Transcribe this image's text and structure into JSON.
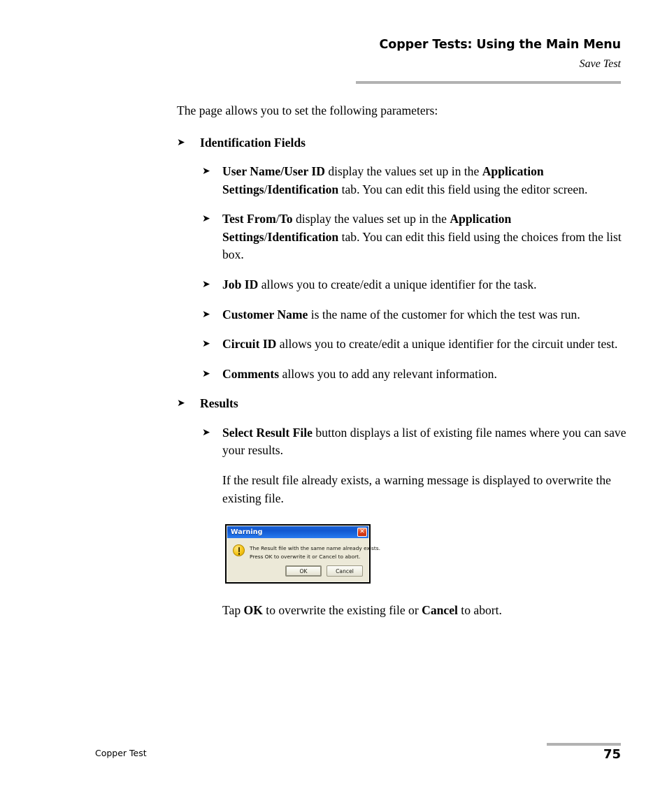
{
  "header": {
    "title": "Copper Tests: Using the Main Menu",
    "subtitle": "Save Test",
    "rule_color": "#b2b2b2"
  },
  "intro": "The page allows you to set the following parameters:",
  "bullet_glyph": "➤",
  "sections": [
    {
      "heading": "Identification Fields",
      "items": [
        {
          "runs": [
            {
              "text": "User Name/User ID",
              "bold": true
            },
            {
              "text": " display the values set up in the ",
              "bold": false
            },
            {
              "text": "Application Settings",
              "bold": true
            },
            {
              "text": "/",
              "bold": false
            },
            {
              "text": "Identification",
              "bold": true
            },
            {
              "text": " tab. You can edit this field using the editor screen.",
              "bold": false
            }
          ]
        },
        {
          "runs": [
            {
              "text": "Test From",
              "bold": true
            },
            {
              "text": "/",
              "bold": false
            },
            {
              "text": "To",
              "bold": true
            },
            {
              "text": " display the values set up in the ",
              "bold": false
            },
            {
              "text": "Application Settings",
              "bold": true
            },
            {
              "text": "/",
              "bold": false
            },
            {
              "text": "Identification",
              "bold": true
            },
            {
              "text": " tab. You can edit this field using the choices from the list box.",
              "bold": false
            }
          ]
        },
        {
          "runs": [
            {
              "text": "Job ID",
              "bold": true
            },
            {
              "text": " allows you to create/edit a unique identifier for the task.",
              "bold": false
            }
          ]
        },
        {
          "runs": [
            {
              "text": "Customer Name",
              "bold": true
            },
            {
              "text": " is the name of the customer for which the test was run.",
              "bold": false
            }
          ]
        },
        {
          "runs": [
            {
              "text": "Circuit ID",
              "bold": true
            },
            {
              "text": " allows you to create/edit a unique identifier for the circuit under test.",
              "bold": false
            }
          ]
        },
        {
          "runs": [
            {
              "text": "Comments",
              "bold": true
            },
            {
              "text": " allows you to add any relevant information.",
              "bold": false
            }
          ]
        }
      ]
    },
    {
      "heading": "Results",
      "items": [
        {
          "runs": [
            {
              "text": "Select Result File",
              "bold": true
            },
            {
              "text": " button displays a list of existing file names where you can save your results.",
              "bold": false
            }
          ]
        }
      ]
    }
  ],
  "result_file_note": "If the result file already exists, a warning message is displayed to overwrite the existing file.",
  "dialog": {
    "title": "Warning",
    "close_label": "✕",
    "icon": "warning-exclamation-icon",
    "message_line1": "The Result file with the same name already exists.",
    "message_line2": "Press OK to overwrite it or Cancel to abort.",
    "ok_label": "OK",
    "cancel_label": "Cancel",
    "titlebar_color": "#1257d0",
    "body_color": "#ece9d8",
    "close_color": "#c42b10",
    "icon_color": "#f5c518"
  },
  "tap_note": {
    "runs": [
      {
        "text": "Tap ",
        "bold": false
      },
      {
        "text": "OK",
        "bold": true
      },
      {
        "text": " to overwrite the existing file or ",
        "bold": false
      },
      {
        "text": "Cancel",
        "bold": true
      },
      {
        "text": " to abort.",
        "bold": false
      }
    ]
  },
  "footer": {
    "left_label": "Copper Test",
    "page_number": "75",
    "rule_color": "#b2b2b2"
  }
}
